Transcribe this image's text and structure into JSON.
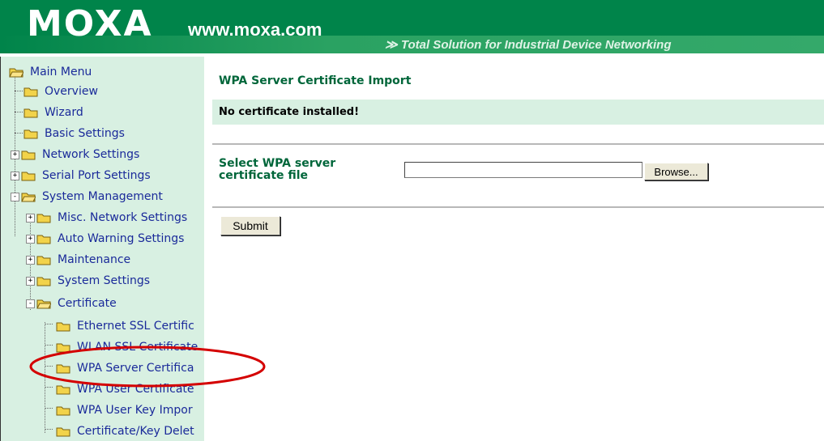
{
  "header": {
    "logo": "MOXA",
    "site": "www.moxa.com",
    "tagline": "≫ Total Solution for Industrial Device Networking"
  },
  "sidebar": {
    "items": [
      {
        "label": "Main Menu",
        "icon": "open-folder-icon"
      },
      {
        "label": "Overview",
        "icon": "folder-icon"
      },
      {
        "label": "Wizard",
        "icon": "folder-icon"
      },
      {
        "label": "Basic Settings",
        "icon": "folder-icon"
      },
      {
        "label": "Network Settings",
        "icon": "folder-icon",
        "expander": "+"
      },
      {
        "label": "Serial Port Settings",
        "icon": "folder-icon",
        "expander": "+"
      },
      {
        "label": "System Management",
        "icon": "open-folder-icon",
        "expander": "-"
      },
      {
        "label": "Misc. Network Settings",
        "icon": "folder-icon",
        "expander": "+"
      },
      {
        "label": "Auto Warning Settings",
        "icon": "folder-icon",
        "expander": "+"
      },
      {
        "label": "Maintenance",
        "icon": "folder-icon",
        "expander": "+"
      },
      {
        "label": "System Settings",
        "icon": "folder-icon",
        "expander": "+"
      },
      {
        "label": "Certificate",
        "icon": "open-folder-icon",
        "expander": "-"
      },
      {
        "label": "Ethernet SSL Certific",
        "icon": "folder-icon"
      },
      {
        "label": "WLAN SSL Certificate",
        "icon": "folder-icon"
      },
      {
        "label": "WPA Server Certifica",
        "icon": "folder-icon"
      },
      {
        "label": "WPA User Certificate",
        "icon": "folder-icon"
      },
      {
        "label": "WPA User Key Impor",
        "icon": "folder-icon"
      },
      {
        "label": "Certificate/Key Delet",
        "icon": "folder-icon"
      }
    ]
  },
  "main": {
    "title": "WPA Server Certificate Import",
    "message": "No certificate installed!",
    "field_label": "Select WPA server certificate file",
    "file_value": "",
    "browse_label": "Browse...",
    "submit_label": "Submit"
  },
  "colors": {
    "brand_green": "#00844a",
    "panel_green": "#d8f0e2",
    "title_green": "#00663a",
    "highlight_oval": "#d40000",
    "link_blue": "#1a2a9a"
  }
}
